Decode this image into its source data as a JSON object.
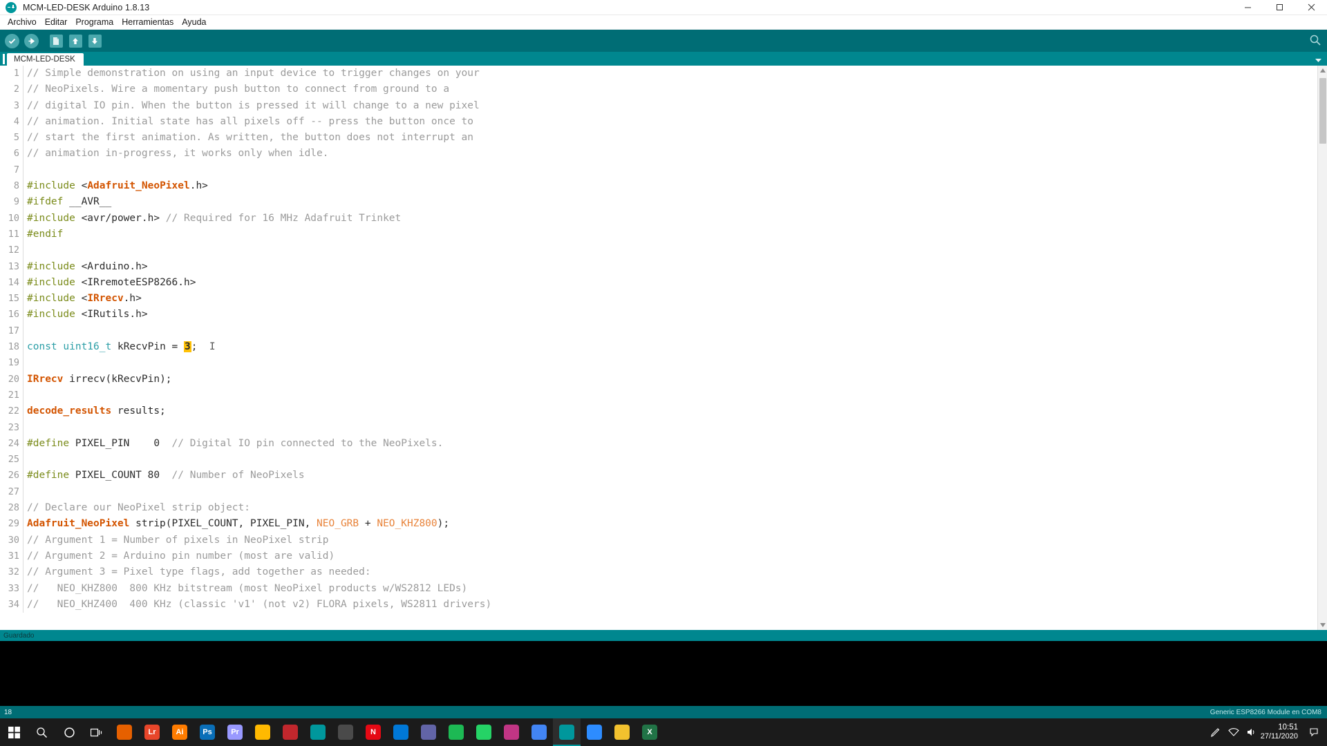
{
  "window": {
    "title": "MCM-LED-DESK Arduino 1.8.13",
    "app_icon": "arduino-infinity-icon",
    "minimize_label": "Minimizar",
    "maximize_label": "Restaurar",
    "close_label": "Cerrar"
  },
  "menu": {
    "items": [
      {
        "label": "Archivo"
      },
      {
        "label": "Editar"
      },
      {
        "label": "Programa"
      },
      {
        "label": "Herramientas"
      },
      {
        "label": "Ayuda"
      }
    ]
  },
  "toolbar": {
    "buttons": [
      {
        "name": "verify-button",
        "icon": "check-icon",
        "label": "Verificar"
      },
      {
        "name": "upload-button",
        "icon": "arrow-right-icon",
        "label": "Subir"
      },
      {
        "name": "new-button",
        "icon": "document-icon",
        "label": "Nuevo"
      },
      {
        "name": "open-button",
        "icon": "arrow-up-icon",
        "label": "Abrir"
      },
      {
        "name": "save-button",
        "icon": "arrow-down-icon",
        "label": "Guardar"
      }
    ],
    "serial_monitor": {
      "name": "serial-monitor-button",
      "icon": "magnifier-icon",
      "label": "Monitor Serie"
    }
  },
  "tabs": {
    "active": "MCM-LED-DESK",
    "items": [
      {
        "label": "MCM-LED-DESK"
      }
    ],
    "menu_icon": "chevron-down-icon"
  },
  "editor": {
    "first_line": 1,
    "lines": [
      {
        "n": 1,
        "tokens": [
          {
            "t": "// Simple demonstration on using an input device to trigger changes on your",
            "c": "cm"
          }
        ]
      },
      {
        "n": 2,
        "tokens": [
          {
            "t": "// NeoPixels. Wire a momentary push button to connect from ground to a",
            "c": "cm"
          }
        ]
      },
      {
        "n": 3,
        "tokens": [
          {
            "t": "// digital IO pin. When the button is pressed it will change to a new pixel",
            "c": "cm"
          }
        ]
      },
      {
        "n": 4,
        "tokens": [
          {
            "t": "// animation. Initial state has all pixels off -- press the button once to",
            "c": "cm"
          }
        ]
      },
      {
        "n": 5,
        "tokens": [
          {
            "t": "// start the first animation. As written, the button does not interrupt an",
            "c": "cm"
          }
        ]
      },
      {
        "n": 6,
        "tokens": [
          {
            "t": "// animation in-progress, it works only when idle.",
            "c": "cm"
          }
        ]
      },
      {
        "n": 7,
        "tokens": []
      },
      {
        "n": 8,
        "tokens": [
          {
            "t": "#include ",
            "c": "pp"
          },
          {
            "t": "<",
            "c": "codetext"
          },
          {
            "t": "Adafruit_NeoPixel",
            "c": "lib"
          },
          {
            "t": ".h>",
            "c": "codetext"
          }
        ]
      },
      {
        "n": 9,
        "tokens": [
          {
            "t": "#ifdef ",
            "c": "pp"
          },
          {
            "t": "__AVR__",
            "c": "codetext"
          }
        ]
      },
      {
        "n": 10,
        "tokens": [
          {
            "t": "#include ",
            "c": "pp"
          },
          {
            "t": "<avr/power.h> ",
            "c": "codetext"
          },
          {
            "t": "// Required for 16 MHz Adafruit Trinket",
            "c": "cm"
          }
        ]
      },
      {
        "n": 11,
        "tokens": [
          {
            "t": "#endif",
            "c": "pp"
          }
        ]
      },
      {
        "n": 12,
        "tokens": []
      },
      {
        "n": 13,
        "tokens": [
          {
            "t": "#include ",
            "c": "pp"
          },
          {
            "t": "<Arduino.h>",
            "c": "codetext"
          }
        ]
      },
      {
        "n": 14,
        "tokens": [
          {
            "t": "#include ",
            "c": "pp"
          },
          {
            "t": "<IRremoteESP8266.h>",
            "c": "codetext"
          }
        ]
      },
      {
        "n": 15,
        "tokens": [
          {
            "t": "#include ",
            "c": "pp"
          },
          {
            "t": "<",
            "c": "codetext"
          },
          {
            "t": "IRrecv",
            "c": "lib"
          },
          {
            "t": ".h>",
            "c": "codetext"
          }
        ]
      },
      {
        "n": 16,
        "tokens": [
          {
            "t": "#include ",
            "c": "pp"
          },
          {
            "t": "<IRutils.h>",
            "c": "codetext"
          }
        ]
      },
      {
        "n": 17,
        "tokens": []
      },
      {
        "n": 18,
        "tokens": [
          {
            "t": "const ",
            "c": "kw"
          },
          {
            "t": "uint16_t",
            "c": "kw"
          },
          {
            "t": " kRecvPin = ",
            "c": "codetext"
          },
          {
            "t": "3",
            "c": "hl"
          },
          {
            "t": ";",
            "c": "codetext"
          }
        ]
      },
      {
        "n": 19,
        "tokens": []
      },
      {
        "n": 20,
        "tokens": [
          {
            "t": "IRrecv",
            "c": "lib"
          },
          {
            "t": " irrecv(kRecvPin);",
            "c": "codetext"
          }
        ]
      },
      {
        "n": 21,
        "tokens": []
      },
      {
        "n": 22,
        "tokens": [
          {
            "t": "decode_results",
            "c": "lib"
          },
          {
            "t": " results;",
            "c": "codetext"
          }
        ]
      },
      {
        "n": 23,
        "tokens": []
      },
      {
        "n": 24,
        "tokens": [
          {
            "t": "#define ",
            "c": "pp"
          },
          {
            "t": "PIXEL_PIN    0  ",
            "c": "codetext"
          },
          {
            "t": "// Digital IO pin connected to the NeoPixels.",
            "c": "cm"
          }
        ]
      },
      {
        "n": 25,
        "tokens": []
      },
      {
        "n": 26,
        "tokens": [
          {
            "t": "#define ",
            "c": "pp"
          },
          {
            "t": "PIXEL_COUNT 80  ",
            "c": "codetext"
          },
          {
            "t": "// Number of NeoPixels",
            "c": "cm"
          }
        ]
      },
      {
        "n": 27,
        "tokens": []
      },
      {
        "n": 28,
        "tokens": [
          {
            "t": "// Declare our NeoPixel strip object:",
            "c": "cm"
          }
        ]
      },
      {
        "n": 29,
        "tokens": [
          {
            "t": "Adafruit_NeoPixel",
            "c": "lib"
          },
          {
            "t": " strip(PIXEL_COUNT, PIXEL_PIN, ",
            "c": "codetext"
          },
          {
            "t": "NEO_GRB",
            "c": "cst"
          },
          {
            "t": " + ",
            "c": "codetext"
          },
          {
            "t": "NEO_KHZ800",
            "c": "cst"
          },
          {
            "t": ");",
            "c": "codetext"
          }
        ]
      },
      {
        "n": 30,
        "tokens": [
          {
            "t": "// Argument 1 = Number of pixels in NeoPixel strip",
            "c": "cm"
          }
        ]
      },
      {
        "n": 31,
        "tokens": [
          {
            "t": "// Argument 2 = Arduino pin number (most are valid)",
            "c": "cm"
          }
        ]
      },
      {
        "n": 32,
        "tokens": [
          {
            "t": "// Argument 3 = Pixel type flags, add together as needed:",
            "c": "cm"
          }
        ]
      },
      {
        "n": 33,
        "tokens": [
          {
            "t": "//   NEO_KHZ800  800 KHz bitstream (most NeoPixel products w/WS2812 LEDs)",
            "c": "cm"
          }
        ]
      },
      {
        "n": 34,
        "tokens": [
          {
            "t": "//   NEO_KHZ400  400 KHz (classic 'v1' (not v2) FLORA pixels, WS2811 drivers)",
            "c": "cm"
          }
        ]
      }
    ]
  },
  "status": {
    "message": "Guardado"
  },
  "footer": {
    "line_number": "18",
    "board": "Generic ESP8266 Module en COM8"
  },
  "taskbar": {
    "start_label": "Inicio",
    "search_label": "Buscar",
    "cortana_label": "Cortana",
    "taskview_label": "Vista de tareas",
    "apps": [
      {
        "name": "taskbar-firefox",
        "label": "Firefox",
        "color": "#e66000",
        "glyph": ""
      },
      {
        "name": "taskbar-lightroom",
        "label": "Lightroom",
        "color": "#e8462a",
        "glyph": "Lr"
      },
      {
        "name": "taskbar-illustrator",
        "label": "Illustrator",
        "color": "#ff7c00",
        "glyph": "Ai"
      },
      {
        "name": "taskbar-photoshop",
        "label": "Photoshop",
        "color": "#0a6fb8",
        "glyph": "Ps"
      },
      {
        "name": "taskbar-premiere",
        "label": "Premiere Pro",
        "color": "#9999ff",
        "glyph": "Pr"
      },
      {
        "name": "taskbar-file-explorer",
        "label": "Explorador de archivos",
        "color": "#ffb900",
        "glyph": ""
      },
      {
        "name": "taskbar-fritzing",
        "label": "Fritzing",
        "color": "#c1272d",
        "glyph": ""
      },
      {
        "name": "taskbar-arduino-web",
        "label": "Arduino Web",
        "color": "#00979c",
        "glyph": ""
      },
      {
        "name": "taskbar-store",
        "label": "Microsoft Store",
        "color": "#4a4a4a",
        "glyph": ""
      },
      {
        "name": "taskbar-netflix",
        "label": "Netflix",
        "color": "#e50914",
        "glyph": "N"
      },
      {
        "name": "taskbar-mail",
        "label": "Correo",
        "color": "#0078d7",
        "glyph": ""
      },
      {
        "name": "taskbar-teams",
        "label": "Microsoft Teams",
        "color": "#6264a7",
        "glyph": ""
      },
      {
        "name": "taskbar-spotify",
        "label": "Spotify",
        "color": "#1db954",
        "glyph": ""
      },
      {
        "name": "taskbar-whatsapp",
        "label": "WhatsApp",
        "color": "#25d366",
        "glyph": ""
      },
      {
        "name": "taskbar-instagram",
        "label": "Instagram",
        "color": "#c13584",
        "glyph": ""
      },
      {
        "name": "taskbar-chrome",
        "label": "Google Chrome",
        "color": "#4285f4",
        "glyph": ""
      },
      {
        "name": "taskbar-arduino-ide",
        "label": "Arduino IDE",
        "color": "#00979c",
        "glyph": ""
      },
      {
        "name": "taskbar-zoom",
        "label": "Zoom",
        "color": "#2d8cff",
        "glyph": ""
      },
      {
        "name": "taskbar-notes",
        "label": "Notas",
        "color": "#f2c12e",
        "glyph": ""
      },
      {
        "name": "taskbar-excel",
        "label": "Excel",
        "color": "#217346",
        "glyph": "X"
      }
    ],
    "tray": {
      "pen_icon": "pen-icon",
      "network_icon": "network-icon",
      "volume_icon": "volume-icon",
      "time": "10:51",
      "date": "27/11/2020",
      "notification_icon": "notification-icon"
    }
  }
}
